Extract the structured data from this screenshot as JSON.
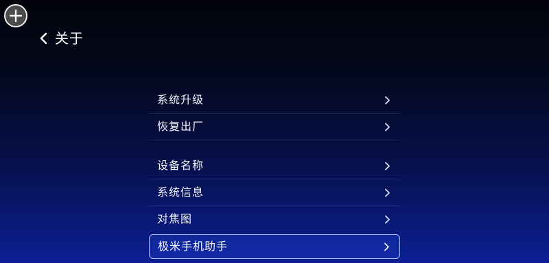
{
  "header": {
    "title": "关于"
  },
  "icons": {
    "add": "plus-circle-icon",
    "back": "chevron-left-icon",
    "row": "chevron-right-icon"
  },
  "menu": {
    "items": [
      {
        "label": "系统升级"
      },
      {
        "label": "恢复出厂"
      },
      {
        "label": "设备名称"
      },
      {
        "label": "系统信息"
      },
      {
        "label": "对焦图"
      },
      {
        "label": "极米手机助手",
        "selected": true
      }
    ]
  },
  "colors": {
    "background_top": "#02030a",
    "background_bottom": "#0a1f95",
    "selection_border": "#c8d7ff"
  }
}
